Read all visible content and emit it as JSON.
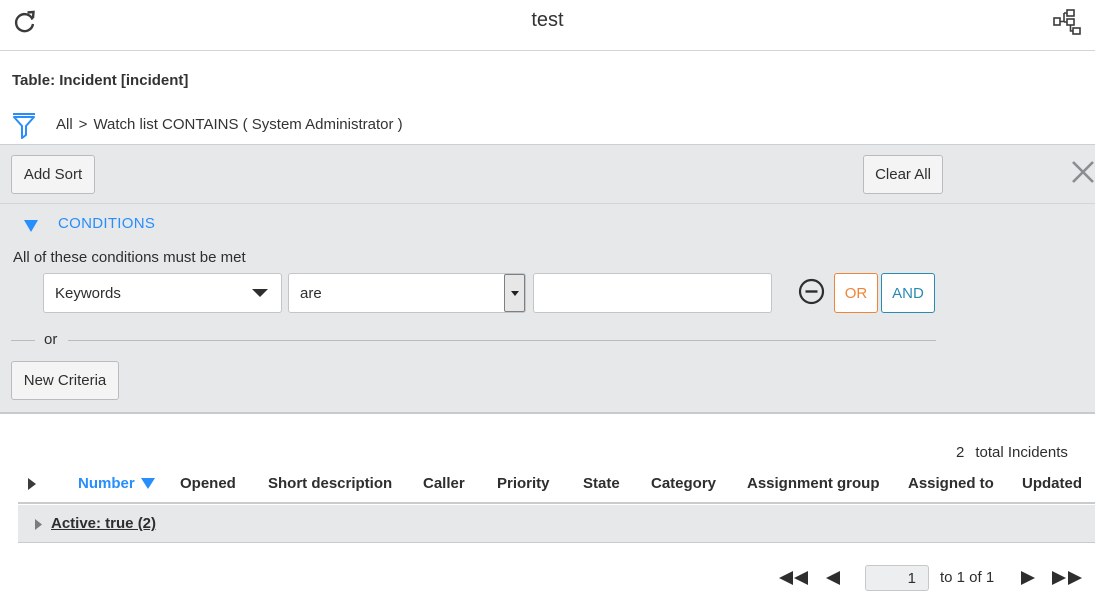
{
  "header": {
    "title": "test",
    "refresh_icon": "refresh-icon",
    "tree_icon": "hierarchy-icon"
  },
  "table_label": "Table: Incident [incident]",
  "breadcrumb": {
    "icon": "filter-icon",
    "all": "All",
    "separator": ">",
    "condition": "Watch list CONTAINS ( System Administrator )"
  },
  "filter": {
    "add_sort": "Add Sort",
    "clear_all": "Clear All",
    "close_icon": "close-icon",
    "conditions_label": "CONDITIONS",
    "conditions_sub": "All of these conditions must be met",
    "field_select": "Keywords",
    "operator_select": "are",
    "value": "",
    "or_button": "OR",
    "and_button": "AND",
    "or_divider": "or",
    "new_criteria": "New Criteria",
    "colors": {
      "accent": "#278efc",
      "or": "#f0843a",
      "and": "#2a8bb0",
      "panel_bg": "#e6e8ea"
    }
  },
  "list": {
    "total_count": "2",
    "total_label": "total Incidents",
    "columns": [
      "Number",
      "Opened",
      "Short description",
      "Caller",
      "Priority",
      "State",
      "Category",
      "Assignment group",
      "Assigned to",
      "Updated"
    ],
    "sorted_column": "Number",
    "group_label": "Active: true (2)"
  },
  "pagination": {
    "current_page": "1",
    "page_of": "to 1 of 1"
  }
}
